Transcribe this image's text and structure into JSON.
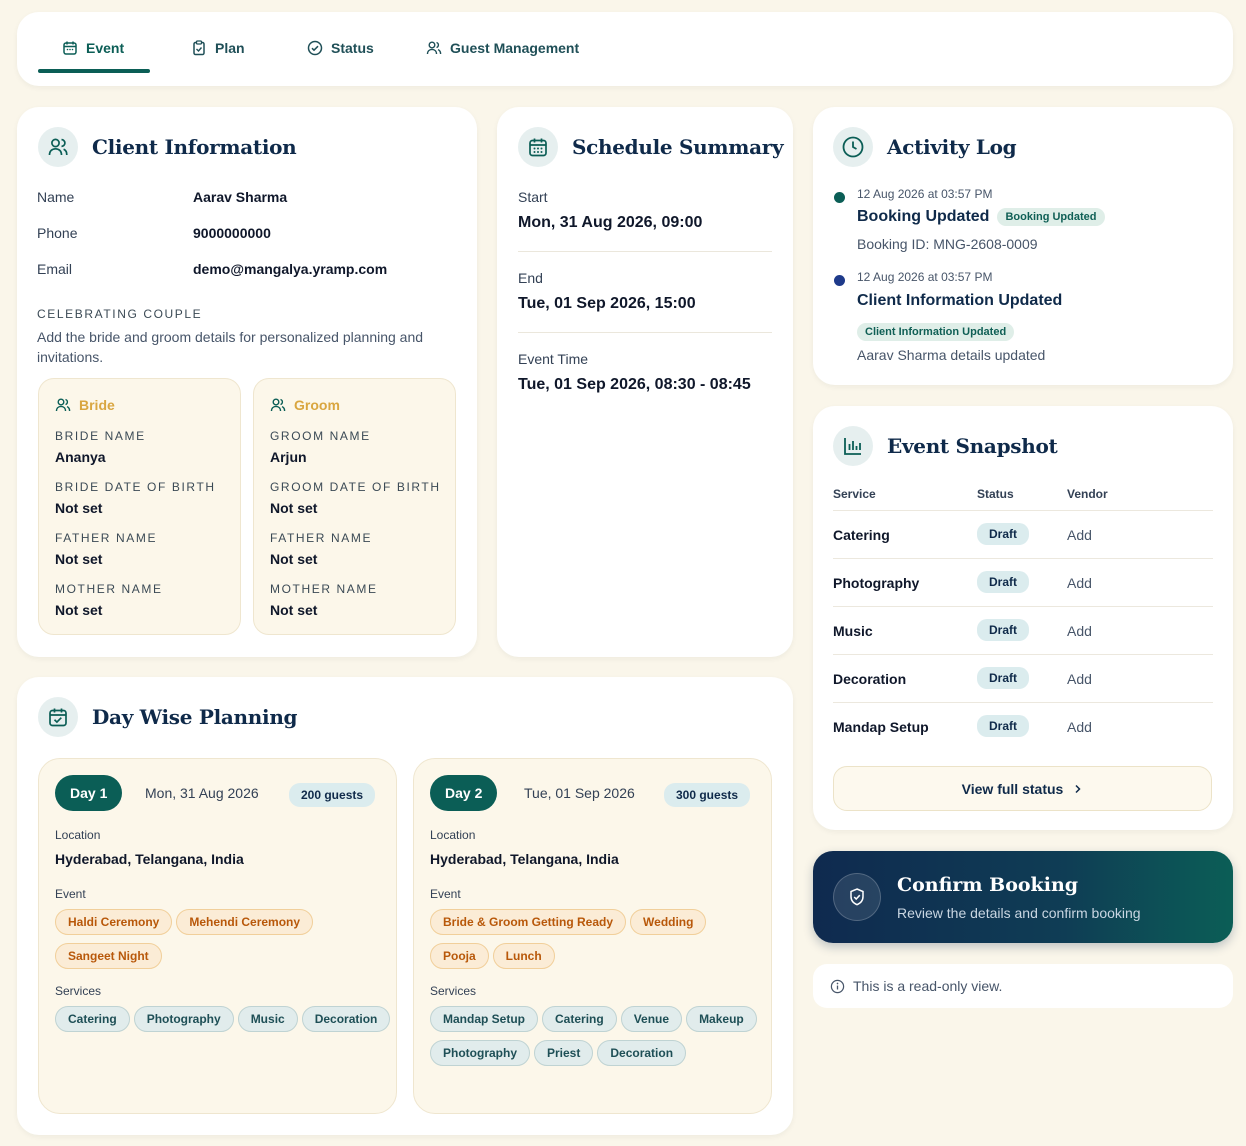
{
  "tabs": [
    {
      "label": "Event",
      "icon": "calendar-icon"
    },
    {
      "label": "Plan",
      "icon": "clipboard-icon"
    },
    {
      "label": "Status",
      "icon": "check-circle-icon"
    },
    {
      "label": "Guest Management",
      "icon": "users-icon"
    }
  ],
  "client": {
    "title": "Client Information",
    "name_label": "Name",
    "name": "Aarav Sharma",
    "phone_label": "Phone",
    "phone": "9000000000",
    "email_label": "Email",
    "email": "demo@mangalya.yramp.com",
    "couple_heading": "CELEBRATING COUPLE",
    "couple_desc": "Add the bride and groom details for personalized planning and invitations.",
    "bride": {
      "title": "Bride",
      "name_label": "BRIDE NAME",
      "name": "Ananya",
      "dob_label": "BRIDE DATE OF BIRTH",
      "dob": "Not set",
      "father_label": "FATHER NAME",
      "father": "Not set",
      "mother_label": "MOTHER NAME",
      "mother": "Not set"
    },
    "groom": {
      "title": "Groom",
      "name_label": "GROOM NAME",
      "name": "Arjun",
      "dob_label": "GROOM DATE OF BIRTH",
      "dob": "Not set",
      "father_label": "FATHER NAME",
      "father": "Not set",
      "mother_label": "MOTHER NAME",
      "mother": "Not set"
    }
  },
  "schedule": {
    "title": "Schedule Summary",
    "start_label": "Start",
    "start": "Mon, 31 Aug 2026, 09:00",
    "end_label": "End",
    "end": "Tue, 01 Sep 2026, 15:00",
    "time_label": "Event Time",
    "time": "Tue, 01 Sep 2026, 08:30 - 08:45"
  },
  "activity": {
    "title": "Activity Log",
    "items": [
      {
        "time": "12 Aug 2026 at 03:57 PM",
        "title": "Booking Updated",
        "badge": "Booking Updated",
        "detail": "Booking ID: MNG-2608-0009",
        "dot": "#0b5e56"
      },
      {
        "time": "12 Aug 2026 at 03:57 PM",
        "title": "Client Information Updated",
        "badge": "Client Information Updated",
        "detail": "Aarav Sharma details updated",
        "dot": "#1e3a8a"
      }
    ]
  },
  "snapshot": {
    "title": "Event Snapshot",
    "col_service": "Service",
    "col_status": "Status",
    "col_vendor": "Vendor",
    "rows": [
      {
        "service": "Catering",
        "status": "Draft",
        "vendor": "Add"
      },
      {
        "service": "Photography",
        "status": "Draft",
        "vendor": "Add"
      },
      {
        "service": "Music",
        "status": "Draft",
        "vendor": "Add"
      },
      {
        "service": "Decoration",
        "status": "Draft",
        "vendor": "Add"
      },
      {
        "service": "Mandap Setup",
        "status": "Draft",
        "vendor": "Add"
      }
    ],
    "view_full": "View full status"
  },
  "confirm": {
    "title": "Confirm Booking",
    "subtitle": "Review the details and confirm booking"
  },
  "readonly": "This is a read-only view.",
  "planning": {
    "title": "Day Wise Planning",
    "days": [
      {
        "badge": "Day 1",
        "date": "Mon, 31 Aug 2026",
        "guests": "200 guests",
        "location_label": "Location",
        "location": "Hyderabad, Telangana, India",
        "event_label": "Event",
        "events": [
          "Haldi Ceremony",
          "Mehendi Ceremony",
          "Sangeet Night"
        ],
        "services_label": "Services",
        "services": [
          "Catering",
          "Photography",
          "Music",
          "Decoration"
        ]
      },
      {
        "badge": "Day 2",
        "date": "Tue, 01 Sep 2026",
        "guests": "300 guests",
        "location_label": "Location",
        "location": "Hyderabad, Telangana, India",
        "event_label": "Event",
        "events": [
          "Bride & Groom Getting Ready",
          "Wedding",
          "Pooja",
          "Lunch"
        ],
        "services_label": "Services",
        "services": [
          "Mandap Setup",
          "Catering",
          "Venue",
          "Makeup",
          "Photography",
          "Priest",
          "Decoration"
        ]
      }
    ]
  },
  "colors": {
    "primary": "#0b5e56",
    "navy": "#0f2a4a",
    "gold": "#d9a640",
    "bg": "#faf6ea"
  }
}
